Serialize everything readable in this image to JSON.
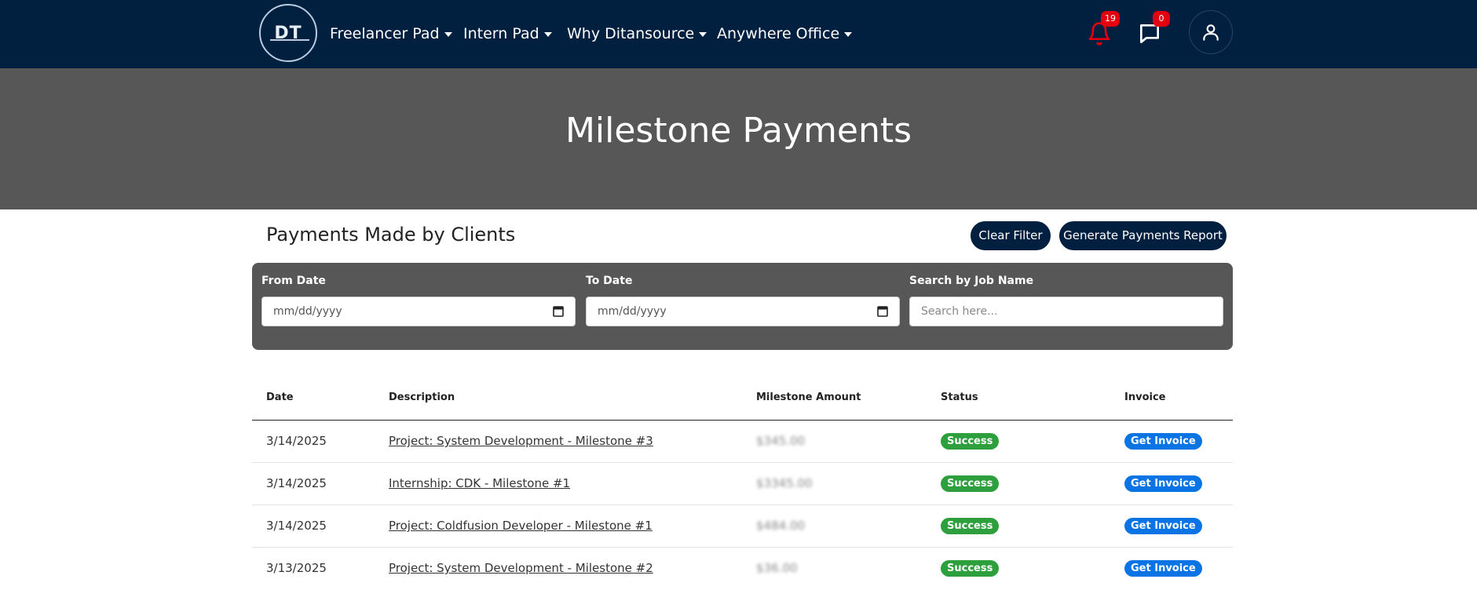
{
  "brand": {
    "logo_text": "DT"
  },
  "nav": {
    "items": [
      {
        "label": "Freelancer Pad"
      },
      {
        "label": "Intern Pad"
      },
      {
        "label": "Why Ditansource"
      },
      {
        "label": "Anywhere Office"
      }
    ],
    "notifications_count": "19",
    "messages_count": "0"
  },
  "hero": {
    "title": "Milestone Payments"
  },
  "section": {
    "title": "Payments Made by Clients",
    "clear_filter_label": "Clear Filter",
    "report_label": "Generate Payments Report"
  },
  "filters": {
    "from_label": "From Date",
    "from_placeholder": "mm/dd/yyyy",
    "to_label": "To Date",
    "to_placeholder": "mm/dd/yyyy",
    "search_label": "Search by Job Name",
    "search_placeholder": "Search here..."
  },
  "table": {
    "columns": [
      "Date",
      "Description",
      "Milestone Amount",
      "Status",
      "Invoice"
    ],
    "rows": [
      {
        "date": "3/14/2025",
        "description": "Project: System Development - Milestone #3",
        "amount": "$345.00",
        "status": "Success",
        "invoice": "Get Invoice"
      },
      {
        "date": "3/14/2025",
        "description": "Internship: CDK - Milestone #1",
        "amount": "$3345.00",
        "status": "Success",
        "invoice": "Get Invoice"
      },
      {
        "date": "3/14/2025",
        "description": "Project: Coldfusion Developer - Milestone #1",
        "amount": "$484.00",
        "status": "Success",
        "invoice": "Get Invoice"
      },
      {
        "date": "3/13/2025",
        "description": "Project: System Development - Milestone #2",
        "amount": "$36.00",
        "status": "Success",
        "invoice": "Get Invoice"
      }
    ]
  },
  "colors": {
    "navbar": "#011f3f",
    "hero": "#575757",
    "success": "#2e9f3d",
    "invoice": "#0a74e4",
    "badge": "#e3000f"
  }
}
